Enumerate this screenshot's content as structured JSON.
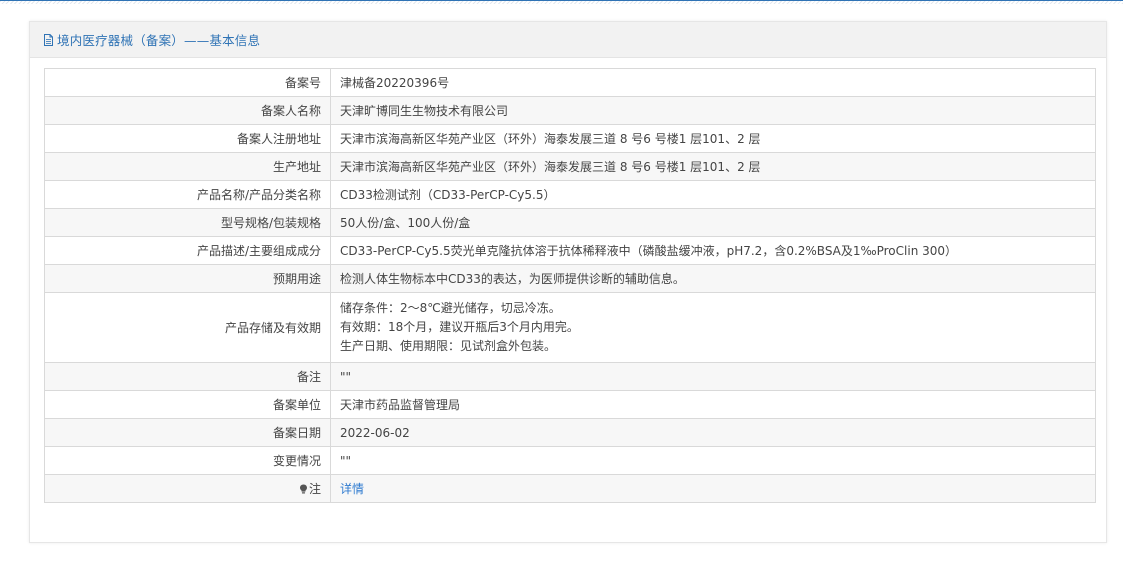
{
  "header": {
    "title": "境内医疗器械（备案）——基本信息"
  },
  "rows": [
    {
      "label": "备案号",
      "value": "津械备20220396号"
    },
    {
      "label": "备案人名称",
      "value": "天津旷博同生生物技术有限公司"
    },
    {
      "label": "备案人注册地址",
      "value": "天津市滨海高新区华苑产业区（环外）海泰发展三道 8 号6 号楼1 层101、2 层"
    },
    {
      "label": "生产地址",
      "value": "天津市滨海高新区华苑产业区（环外）海泰发展三道 8 号6 号楼1 层101、2 层"
    },
    {
      "label": "产品名称/产品分类名称",
      "value": "CD33检测试剂（CD33-PerCP-Cy5.5）"
    },
    {
      "label": "型号规格/包装规格",
      "value": "50人份/盒、100人份/盒"
    },
    {
      "label": "产品描述/主要组成成分",
      "value": "CD33-PerCP-Cy5.5荧光单克隆抗体溶于抗体稀释液中（磷酸盐缓冲液，pH7.2，含0.2%BSA及1‰ProClin 300）"
    },
    {
      "label": "预期用途",
      "value": "检测人体生物标本中CD33的表达，为医师提供诊断的辅助信息。"
    },
    {
      "label": "产品存储及有效期",
      "lines": [
        "储存条件：2～8℃避光储存，切忌冷冻。",
        "有效期：18个月，建议开瓶后3个月内用完。",
        "生产日期、使用期限：见试剂盒外包装。"
      ]
    },
    {
      "label": "备注",
      "value": "\"\""
    },
    {
      "label": "备案单位",
      "value": "天津市药品监督管理局"
    },
    {
      "label": "备案日期",
      "value": "2022-06-02"
    },
    {
      "label": "变更情况",
      "value": "\"\""
    },
    {
      "label": "注",
      "value": "详情"
    }
  ],
  "icons": {
    "header_icon": "document-icon",
    "note_icon": "lightbulb-icon"
  },
  "colors": {
    "accent": "#2f73b5",
    "link": "#2f7bd0"
  }
}
